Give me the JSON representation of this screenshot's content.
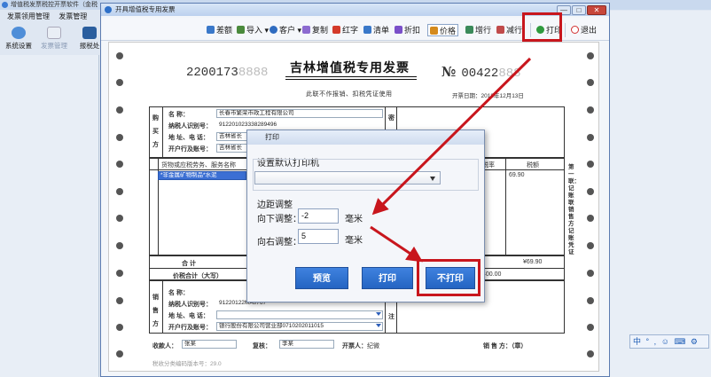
{
  "bg_window": {
    "title": "增值税发票税控开票软件（金税",
    "menu": [
      "发票领用管理",
      "发票管理"
    ],
    "tools": [
      "系统设置",
      "发票管理",
      "报税处"
    ]
  },
  "window": {
    "title": "开具增值税专用发票",
    "controls": [
      "—",
      "□",
      "✕"
    ]
  },
  "toolbar": {
    "items": [
      "差额",
      "导入",
      "客户",
      "复制",
      "红字",
      "清单",
      "折扣",
      "价格",
      "增行",
      "减行",
      "打印",
      "退出"
    ]
  },
  "invoice": {
    "code_prefix": "2200173",
    "code_hidden": "8888",
    "title": "吉林增值税专用发票",
    "no_symbol": "№",
    "no_prefix": "00422",
    "no_hidden": "888",
    "subtitle": "此联不作报销、扣税凭证使用",
    "date_label": "开票日期：",
    "date_value": "2018年12月13日",
    "buyer_side": [
      "购",
      "买",
      "方"
    ],
    "buyer_labels": [
      "名      称：",
      "纳税人识别号：",
      "地 址、电 话：",
      "开户行及账号："
    ],
    "buyer_values": [
      "长春市繁荣市政工程有限公司",
      "912201023338289496",
      "吉林省长",
      "吉林省长"
    ],
    "password_side": "密",
    "items_header": "货物或应税劳务、服务名称",
    "items_row1": "*非金属矿物制品*水泥",
    "tax_rate_header": "税率",
    "tax_header": "税额",
    "tax_value": "69.90",
    "total_label": "合        计",
    "total_tax": "¥69.90",
    "total_words_label": "价税合计（大写）",
    "total_amount": "400.00",
    "seller_side": [
      "销",
      "售",
      "方"
    ],
    "seller_labels": [
      "名      称：",
      "纳税人识别号：",
      "地 址、电 话：",
      "开户行及账号："
    ],
    "seller_values": [
      "",
      "91220122MA0767",
      "",
      "银行股份有限公司营业部0710202011015"
    ],
    "remark_side": "注",
    "payee_label": "收款人：",
    "payee_value": "张某",
    "reviewer_label": "复核：",
    "reviewer_value": "李某",
    "drawer_label": "开票人：",
    "drawer_value": "纪微",
    "seller_stamp_label": "销 售 方：（章）",
    "version_note": "税收分类编码版本号：29.0",
    "right_margin_text": "第一联：记账联 销售方记账凭证"
  },
  "print_dialog": {
    "title": "打印",
    "printer_label": "设置默认打印机",
    "printer_value": "",
    "margin_group_label": "边距调整",
    "down_label": "向下调整：",
    "down_value": "-2",
    "right_label": "向右调整：",
    "right_value": "5",
    "unit": "毫米",
    "buttons": [
      "预览",
      "打印",
      "不打印"
    ]
  },
  "ime": {
    "items": [
      "中",
      "°",
      ",",
      "☺",
      "⌨",
      "👕",
      "⚙"
    ]
  },
  "annotation_color": "#c8161d"
}
